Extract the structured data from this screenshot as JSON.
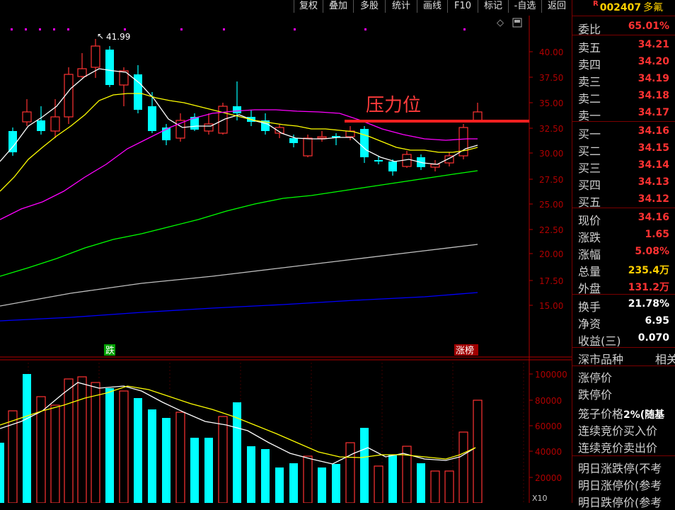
{
  "toolbar": {
    "buttons": [
      "复权",
      "叠加",
      "多股",
      "统计",
      "画线",
      "F10",
      "标记",
      "-自选",
      "返回"
    ]
  },
  "stock": {
    "marker": "R",
    "code": "002407",
    "name": "多氟"
  },
  "chart": {
    "annotation": "压力位",
    "high_label": "41.99",
    "price_ticks": [
      "40.00",
      "37.50",
      "35.00",
      "32.50",
      "30.00",
      "27.50",
      "25.00",
      "22.50",
      "20.00",
      "17.50",
      "15.00"
    ],
    "volume_ticks": [
      "100000",
      "80000",
      "60000",
      "40000",
      "20000"
    ],
    "volume_unit": "X10",
    "signals": {
      "down": "跌",
      "up": "涨榜"
    }
  },
  "quote": {
    "ratio": {
      "label": "委比",
      "value": "65.01%"
    },
    "asks": [
      {
        "label": "卖五",
        "value": "34.21"
      },
      {
        "label": "卖四",
        "value": "34.20"
      },
      {
        "label": "卖三",
        "value": "34.19"
      },
      {
        "label": "卖二",
        "value": "34.18"
      },
      {
        "label": "卖一",
        "value": "34.17"
      }
    ],
    "bids": [
      {
        "label": "买一",
        "value": "34.16"
      },
      {
        "label": "买二",
        "value": "34.15"
      },
      {
        "label": "买三",
        "value": "34.14"
      },
      {
        "label": "买四",
        "value": "34.13"
      },
      {
        "label": "买五",
        "value": "34.12"
      }
    ],
    "stats1": [
      {
        "label": "现价",
        "value": "34.16"
      },
      {
        "label": "涨跌",
        "value": "1.65"
      },
      {
        "label": "涨幅",
        "value": "5.08%"
      },
      {
        "label": "总量",
        "value": "235.4万"
      },
      {
        "label": "外盘",
        "value": "131.2万"
      }
    ],
    "stats2": [
      {
        "label": "换手",
        "value": "21.78%"
      },
      {
        "label": "净资",
        "value": "6.95"
      },
      {
        "label": "收益(三)",
        "value": "0.070"
      }
    ],
    "section_title": "深市品种",
    "section_right": "相关",
    "limit_up": "涨停价",
    "limit_down": "跌停价",
    "cage": {
      "label": "笼子价格",
      "value": "2%(随基"
    },
    "auction_buy": "连续竞价买入价",
    "auction_sell": "连续竞价卖出价",
    "tomorrow": [
      "明日涨跌停(不考",
      "明日涨停价(参考",
      "明日跌停价(参考"
    ]
  },
  "colors": {
    "up": "#ff3232",
    "down": "#00ffff",
    "ma5": "#ffffff",
    "ma10": "#ffff00",
    "ma20": "#ff00ff",
    "ma60": "#00ff00",
    "ma120": "#c0c0c0",
    "ma250": "#0000ff"
  }
}
